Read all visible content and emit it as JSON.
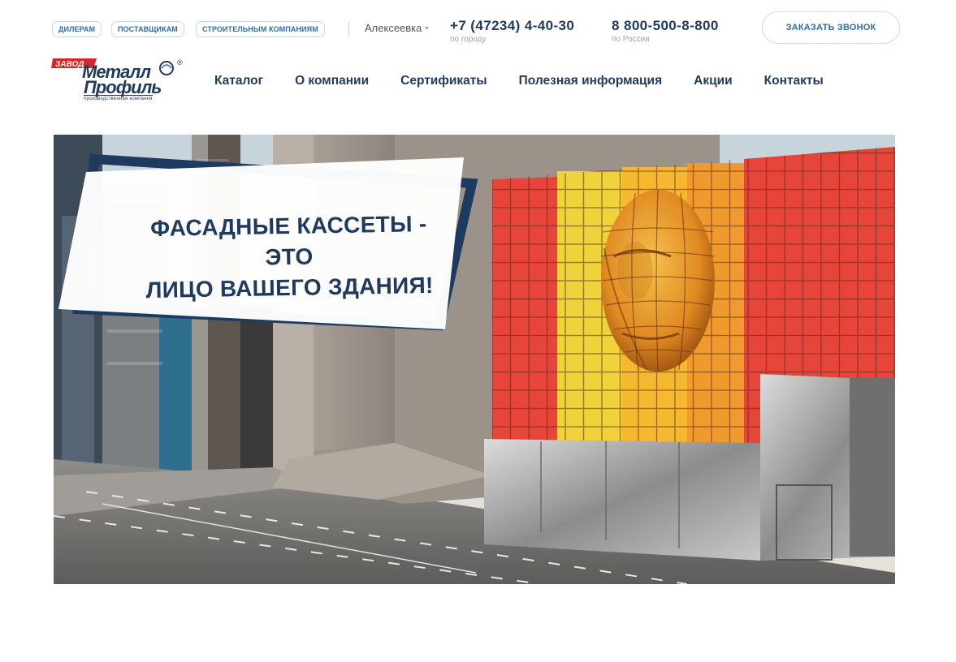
{
  "topbar": {
    "pills": [
      "Дилерам",
      "Поставщикам",
      "Строительным компаниям"
    ],
    "city": "Алексеевка",
    "phones": [
      {
        "number": "+7 (47234) 4-40-30",
        "caption": "по городу"
      },
      {
        "number": "8 800-500-8-800",
        "caption": "по России"
      }
    ],
    "callback_label": "Заказать звонок"
  },
  "logo": {
    "badge": "ЗАВОД",
    "line1": "Металл",
    "line2": "Профиль",
    "reg": "®",
    "tagline": "производственная компания"
  },
  "nav": {
    "items": [
      "Каталог",
      "О компании",
      "Сертификаты",
      "Полезная информация",
      "Акции",
      "Контакты"
    ]
  },
  "hero": {
    "title_line1": "Фасадные кассеты - это",
    "title_line2": "лицо вашего здания!"
  },
  "colors": {
    "brand_navy": "#1f3a5f",
    "brand_blue": "#2f6ea5",
    "logo_red": "#d6262b",
    "tile_red": "#e8453a",
    "tile_yellow": "#f0d23a",
    "tile_orange": "#f09a2e"
  }
}
